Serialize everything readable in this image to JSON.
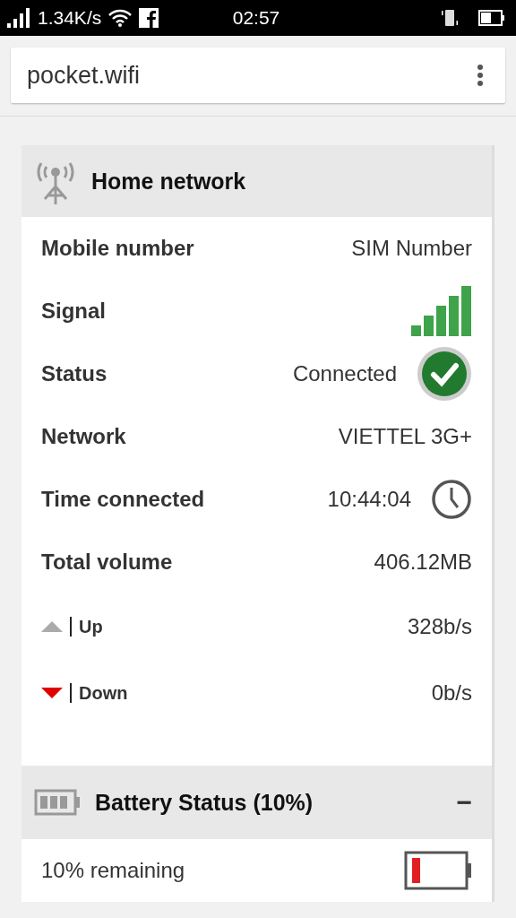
{
  "status_bar": {
    "network_speed": "1.34K/s",
    "time": "02:57"
  },
  "address_bar": {
    "url": "pocket.wifi"
  },
  "home_network": {
    "title": "Home network",
    "rows": [
      {
        "kind": "text",
        "label": "Mobile number",
        "value": "SIM Number"
      },
      {
        "kind": "signal",
        "label": "Signal"
      },
      {
        "kind": "status",
        "label": "Status",
        "value": "Connected"
      },
      {
        "kind": "text",
        "label": "Network",
        "value": "VIETTEL 3G+"
      },
      {
        "kind": "clock",
        "label": "Time connected",
        "value": "10:44:04"
      },
      {
        "kind": "text",
        "label": "Total volume",
        "value": "406.12MB"
      },
      {
        "kind": "up",
        "label": "Up",
        "value": "328b/s"
      },
      {
        "kind": "down",
        "label": "Down",
        "value": "0b/s"
      }
    ]
  },
  "battery_status": {
    "title": "Battery Status (10%)",
    "toggle": "−",
    "remaining": "10% remaining"
  }
}
